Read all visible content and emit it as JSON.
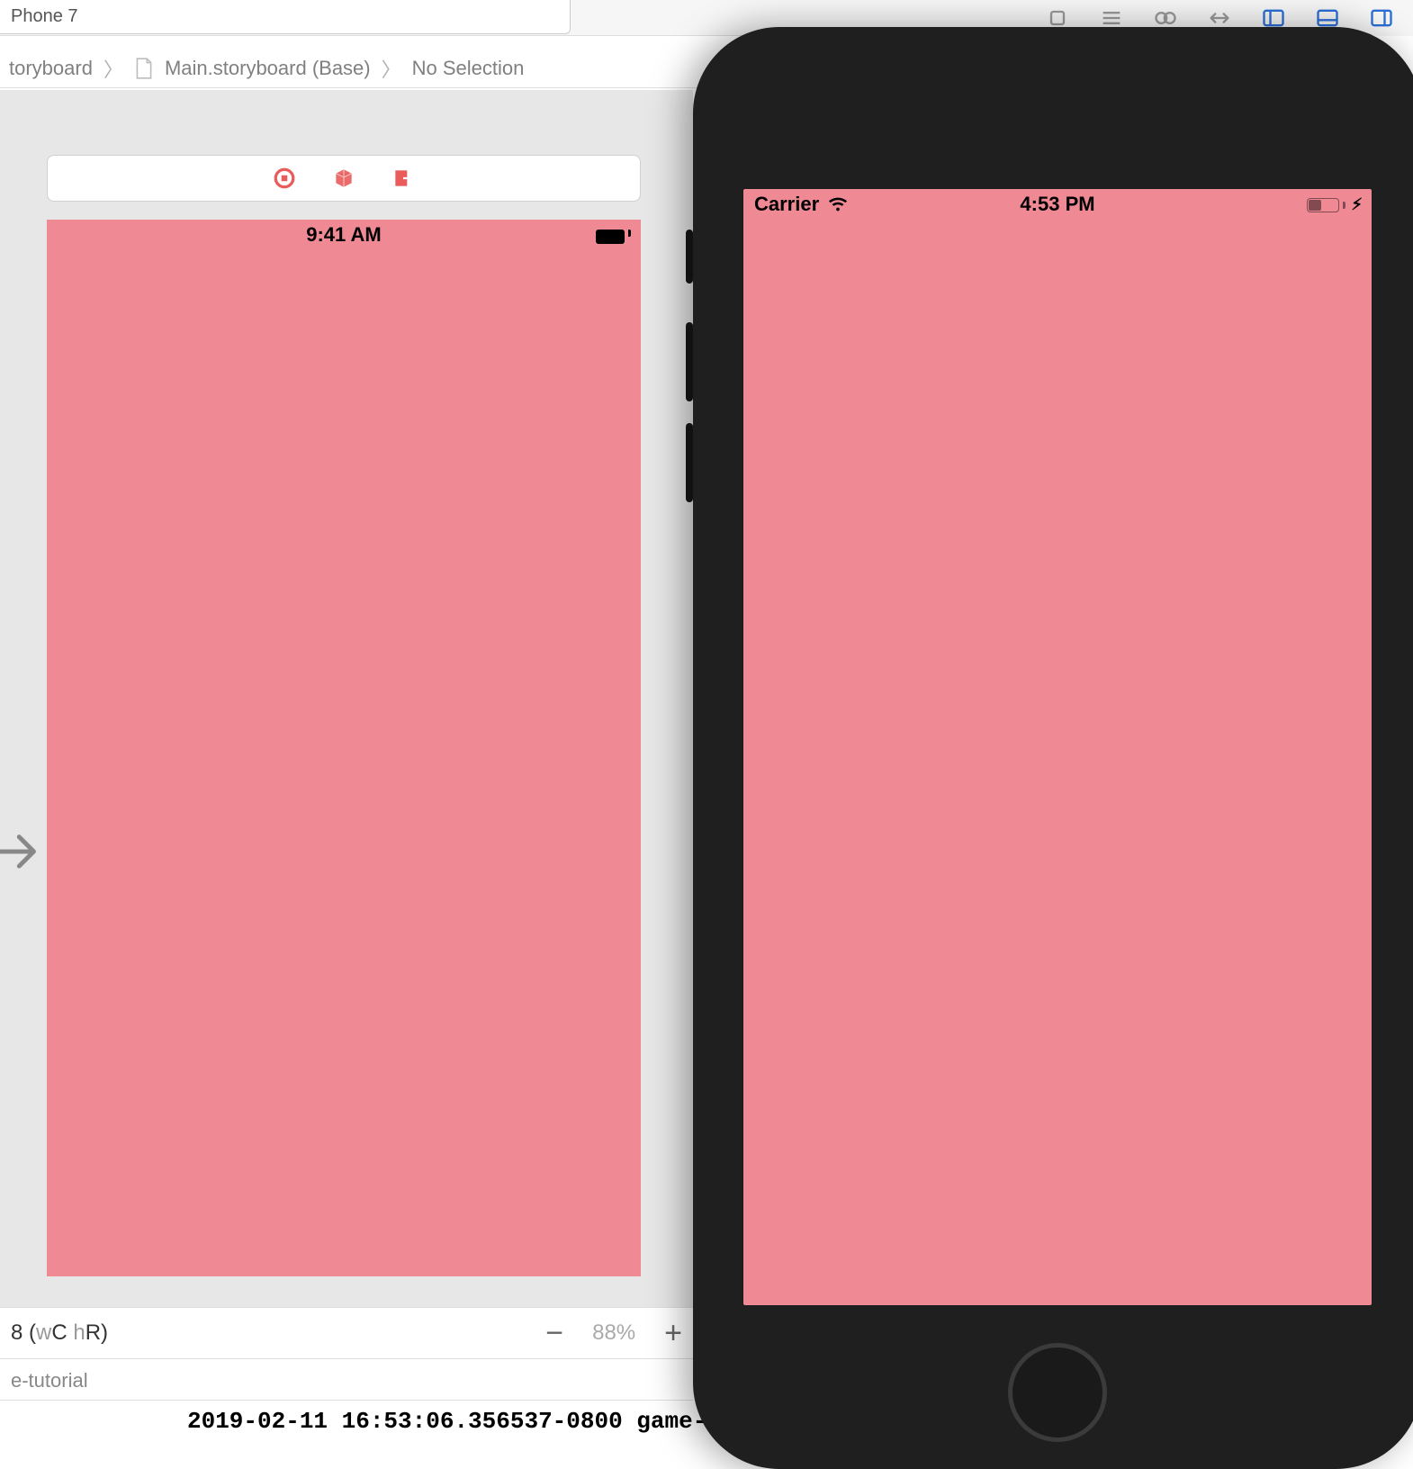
{
  "device_selector": {
    "value": "Phone 7"
  },
  "breadcrumb": {
    "items": [
      "toryboard",
      "Main.storyboard (Base)",
      "No Selection"
    ]
  },
  "ib": {
    "status_time": "9:41 AM",
    "view_bg": "#ef8994"
  },
  "footer": {
    "size_class_prefix": "8 (",
    "w_muted": "w",
    "c": "C ",
    "h_muted": "h",
    "r_close": "R)",
    "zoom": "88%"
  },
  "bottom_tab": {
    "label": "e-tutorial"
  },
  "console": {
    "line": "2019-02-11 16:53:06.356537-0800 game-"
  },
  "simulator": {
    "carrier": "Carrier",
    "time": "4:53 PM",
    "bolt": "⚡︎"
  },
  "colors": {
    "pink": "#ef8994",
    "accent_red": "#e95c5b",
    "blue": "#2a6fd6"
  }
}
